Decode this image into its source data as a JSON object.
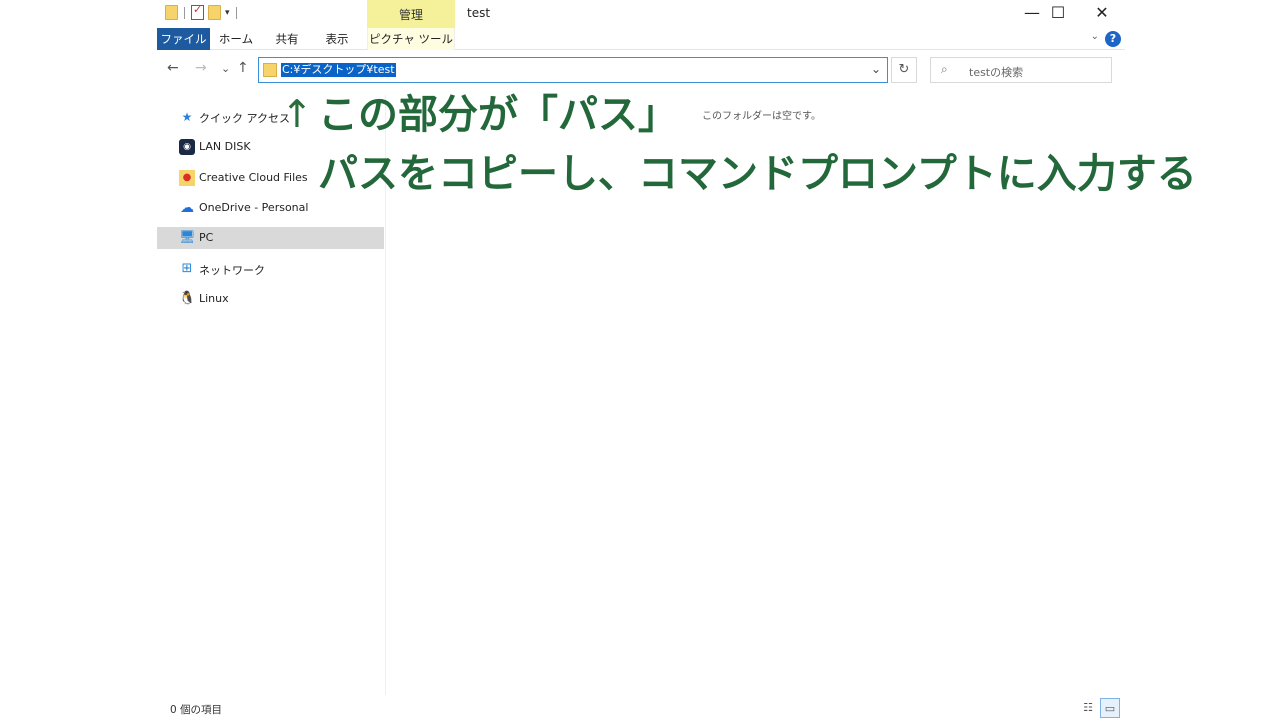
{
  "window": {
    "title": "test",
    "manage_tab": "管理",
    "controls": {
      "minimize": "—",
      "maximize": "☐",
      "close": "✕"
    }
  },
  "ribbon": {
    "tabs": [
      "ファイル",
      "ホーム",
      "共有",
      "表示",
      "ピクチャ ツール"
    ],
    "help": "?"
  },
  "nav": {
    "back": "←",
    "forward": "→",
    "recent": "⌄",
    "up": "↑",
    "path": "C:¥デスクトップ¥test",
    "dropdown": "⌄",
    "refresh": "↻",
    "search_icon": "⌕",
    "search_placeholder": "testの検索"
  },
  "sidebar": {
    "items": [
      {
        "label": "クイック アクセス",
        "icon": "star-icon"
      },
      {
        "label": "LAN DISK",
        "icon": "lan-disk-icon"
      },
      {
        "label": "Creative Cloud Files",
        "icon": "creative-cloud-icon"
      },
      {
        "label": "OneDrive - Personal",
        "icon": "cloud-icon"
      },
      {
        "label": "PC",
        "icon": "pc-icon",
        "selected": true
      },
      {
        "label": "ネットワーク",
        "icon": "network-icon"
      },
      {
        "label": "Linux",
        "icon": "linux-icon"
      }
    ]
  },
  "content": {
    "empty_message": "このフォルダーは空です。"
  },
  "annotation": {
    "arrow": "↑",
    "line1": "この部分が「パス」",
    "line2": "パスをコピーし、コマンドプロンプトに入力する",
    "color": "#23683a"
  },
  "status": {
    "item_count": "0 個の項目"
  },
  "colors": {
    "file_tab": "#1d5aa0",
    "manage_tab": "#f4f19a",
    "selection": "#0a64c7",
    "address_border": "#3a8fd6"
  }
}
